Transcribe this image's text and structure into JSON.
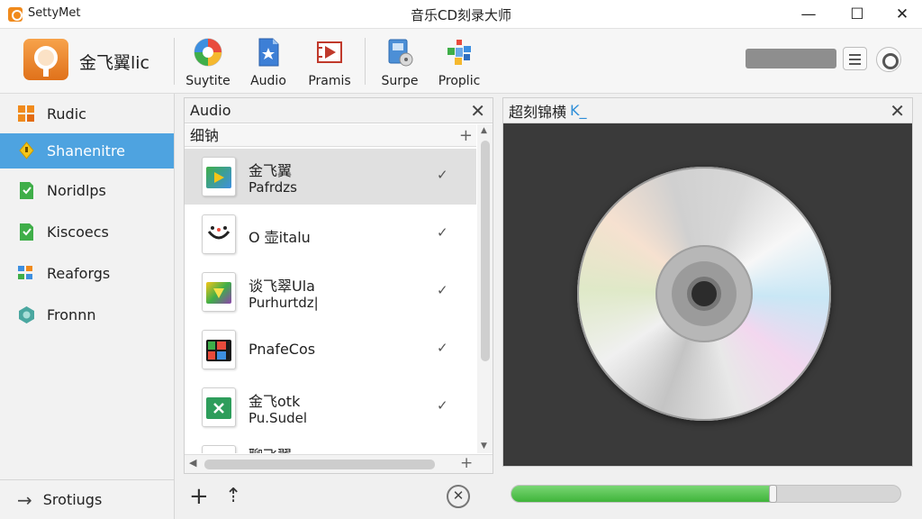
{
  "titlebar": {
    "app_name": "SettyMet",
    "title": "音乐CD刻录大师",
    "min": "—",
    "max": "☐",
    "close": "✕"
  },
  "toolbar": {
    "brand_name": "金飞翼lic",
    "buttons": [
      {
        "label": "Suytite",
        "icon": "palette-icon"
      },
      {
        "label": "Audio",
        "icon": "audio-file-icon"
      },
      {
        "label": "Pramis",
        "icon": "film-icon"
      },
      {
        "label": "Surpe",
        "icon": "disk-copy-icon"
      },
      {
        "label": "Proplic",
        "icon": "puzzle-icon"
      }
    ]
  },
  "sidebar": {
    "items": [
      {
        "label": "Rudic",
        "icon": "grid-icon"
      },
      {
        "label": "Shanenitre",
        "icon": "lightbulb-icon"
      },
      {
        "label": "Noridlps",
        "icon": "green-file-icon"
      },
      {
        "label": "Kiscoecs",
        "icon": "green-file-icon"
      },
      {
        "label": "Reaforgs",
        "icon": "blocks-icon"
      },
      {
        "label": "Fronnn",
        "icon": "globe-icon"
      }
    ],
    "bottom": {
      "label": "Srotiugs",
      "arrow": "→"
    }
  },
  "center": {
    "header": "Audio",
    "close": "✕",
    "filter": "细钠",
    "filter_plus": "+",
    "files": [
      {
        "name": "金飞翼",
        "sub": "Pafrdzs",
        "check": "✓"
      },
      {
        "name": "O 壶italu",
        "sub": "",
        "check": "✓"
      },
      {
        "name": "谈飞翠Ula",
        "sub": "Purhurtdz|",
        "check": "✓"
      },
      {
        "name": "PnafeCos",
        "sub": "",
        "check": "✓"
      },
      {
        "name": "金飞otk",
        "sub": "Pu.Sudel",
        "check": "✓"
      }
    ],
    "partial_item": "聊飞翼",
    "scroll_up": "▲",
    "scroll_down": "▼",
    "hscroll_left": "◀",
    "hscroll_plus": "+",
    "bottom": {
      "add": "+",
      "upload": "⇡",
      "cancel": "✕"
    }
  },
  "preview": {
    "header": "超刻锦横",
    "cursor": "K_",
    "close": "✕"
  },
  "progress": {
    "value": 0.67
  }
}
